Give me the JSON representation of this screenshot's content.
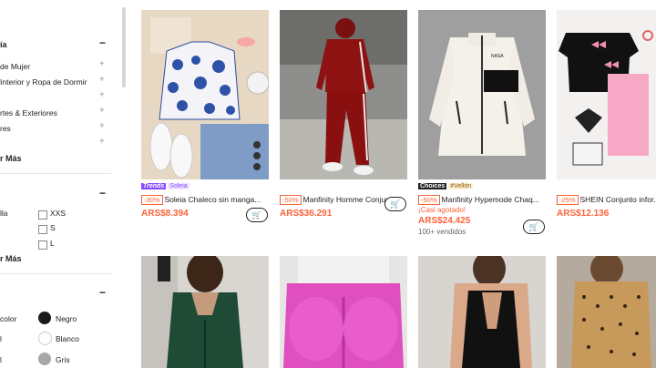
{
  "sidebar": {
    "category_title": "ía",
    "category_items": [
      "de Mujer",
      "Interior y Ropa de Dormir",
      "rtes & Exteriores",
      "res"
    ],
    "see_more_1": "r Más",
    "sizes": [
      "XXS",
      "S",
      "L"
    ],
    "size_label_cut": "lla",
    "see_more_2": "r Más",
    "colors": [
      {
        "name": "Negro",
        "hex": "#1a1a1a"
      },
      {
        "name": "Blanco",
        "hex": "#ffffff"
      },
      {
        "name": "Gris",
        "hex": "#a8a8a8"
      }
    ],
    "color_cut_labels": [
      "color",
      "",
      "l"
    ]
  },
  "products": [
    {
      "badge1": "Trends",
      "badge2": "Soleia",
      "discount": "-30%",
      "title": "Soleia Chaleco sin manga...",
      "price": "ARS$8.394",
      "theme": "blue-floral"
    },
    {
      "badge1": "",
      "badge2": "",
      "discount": "-50%",
      "title": "Manfinity Homme Conjunt...",
      "price": "ARS$36.291",
      "theme": "red-tracksuit"
    },
    {
      "badge1": "Choices",
      "badge2": "#Vellón",
      "discount": "-50%",
      "title": "Manfinity Hypemode Chaq...",
      "price": "ARS$24.425",
      "extra": "¡Casi agotado!",
      "sold": "100+ vendidos",
      "theme": "fleece"
    },
    {
      "badge1": "",
      "badge2": "",
      "discount": "-25%",
      "title": "SHEIN Conjunto infor...",
      "price": "ARS$12.136",
      "theme": "kids-pink"
    }
  ],
  "colors": {
    "accent": "#fa6338",
    "trends": "#8a4bff",
    "choices": "#222222",
    "link_orange": "#fa6338"
  }
}
